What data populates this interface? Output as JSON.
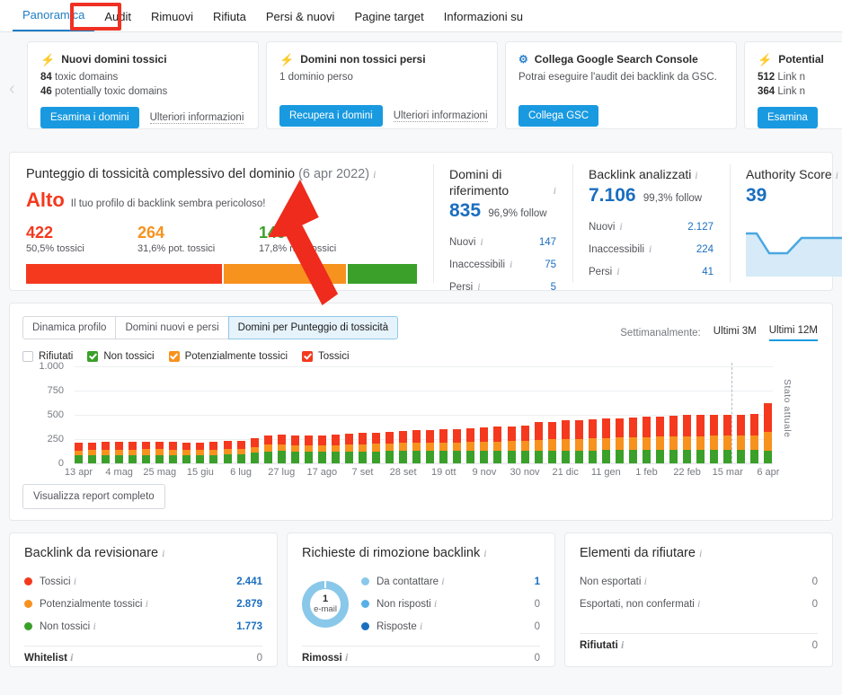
{
  "tabs": [
    {
      "label": "Panoramica",
      "active": true
    },
    {
      "label": "Audit",
      "active": false,
      "highlighted": true
    },
    {
      "label": "Rimuovi",
      "active": false
    },
    {
      "label": "Rifiuta",
      "active": false
    },
    {
      "label": "Persi & nuovi",
      "active": false
    },
    {
      "label": "Pagine target",
      "active": false
    },
    {
      "label": "Informazioni su",
      "active": false
    }
  ],
  "notifications": {
    "prev_arrow": "‹",
    "next_arrow": "›",
    "cards": [
      {
        "icon": "bolt-icon",
        "icon_color": "#f4391e",
        "title": "Nuovi domini tossici",
        "line1_value": "84",
        "line1_text": "toxic domains",
        "line2_value": "46",
        "line2_text": "potentially toxic domains",
        "button": "Esamina i domini",
        "link": "Ulteriori informazioni"
      },
      {
        "icon": "bolt-icon",
        "icon_color": "#f4391e",
        "title": "Domini non tossici persi",
        "line1_value": "1",
        "line1_text": "dominio perso",
        "line2_value": "",
        "line2_text": "",
        "button": "Recupera i domini",
        "link": "Ulteriori informazioni"
      },
      {
        "icon": "gear-icon",
        "icon_color": "#2a7fc9",
        "title": "Collega Google Search Console",
        "line1_value": "",
        "line1_text": "Potrai eseguire l'audit dei backlink da GSC.",
        "line2_value": "",
        "line2_text": "",
        "button": "Collega GSC",
        "link": ""
      },
      {
        "icon": "bolt-icon",
        "icon_color": "#f7921e",
        "title": "Potential",
        "line1_value": "512",
        "line1_text": "Link n",
        "line2_value": "364",
        "line2_text": "Link n",
        "button": "Esamina",
        "link": ""
      }
    ]
  },
  "toxicity": {
    "title": "Punteggio di tossicità complessivo del dominio",
    "date": "(6 apr 2022)",
    "info_icon": "i",
    "verdict": "Alto",
    "verdict_sub": "Il tuo profilo di backlink sembra pericoloso!",
    "segments": [
      {
        "value": "422",
        "label": "50,5% tossici",
        "color": "#f4391e",
        "pct": 50.5
      },
      {
        "value": "264",
        "label": "31,6% pot. tossici",
        "color": "#f7921e",
        "pct": 31.6
      },
      {
        "value": "149",
        "label": "17,8% non tossici",
        "color": "#3aa02a",
        "pct": 17.8
      }
    ]
  },
  "referring_domains": {
    "title": "Domini di riferimento",
    "big": "835",
    "side": "96,9% follow",
    "rows": [
      {
        "label": "Nuovi",
        "value": "147"
      },
      {
        "label": "Inaccessibili",
        "value": "75"
      },
      {
        "label": "Persi",
        "value": "5"
      }
    ]
  },
  "backlinks": {
    "title": "Backlink analizzati",
    "big": "7.106",
    "side": "99,3% follow",
    "rows": [
      {
        "label": "Nuovi",
        "value": "2.127"
      },
      {
        "label": "Inaccessibili",
        "value": "224"
      },
      {
        "label": "Persi",
        "value": "41"
      }
    ]
  },
  "authority_score": {
    "title": "Authority Score",
    "big": "39"
  },
  "chart_panel": {
    "segments": [
      {
        "label": "Dinamica profilo",
        "active": false
      },
      {
        "label": "Domini nuovi e persi",
        "active": false
      },
      {
        "label": "Domini per Punteggio di tossicità",
        "active": true
      }
    ],
    "legend": [
      {
        "label": "Rifiutati",
        "color": "#ffffff",
        "checked": false
      },
      {
        "label": "Non tossici",
        "color": "#3aa02a",
        "checked": true
      },
      {
        "label": "Potenzialmente tossici",
        "color": "#f7921e",
        "checked": true
      },
      {
        "label": "Tossici",
        "color": "#f4391e",
        "checked": true
      }
    ],
    "period_label": "Settimanalmente:",
    "period_options": [
      {
        "label": "Ultimi 3M",
        "active": false
      },
      {
        "label": "Ultimi 12M",
        "active": true
      }
    ],
    "current_marker_label": "Stato attuale",
    "full_report_button": "Visualizza report completo"
  },
  "chart_data": {
    "type": "bar",
    "title": "Domini per Punteggio di tossicità",
    "stacked": true,
    "xlabel": "",
    "ylabel": "",
    "ylim": [
      0,
      1000
    ],
    "yticks": [
      "1.000",
      "750",
      "500",
      "250",
      "0"
    ],
    "grid": true,
    "legend_position": "top-left",
    "categories": [
      "13 apr",
      "20 apr",
      "27 apr",
      "4 mag",
      "11 mag",
      "18 mag",
      "25 mag",
      "1 giu",
      "8 giu",
      "15 giu",
      "22 giu",
      "29 giu",
      "6 lug",
      "13 lug",
      "20 lug",
      "27 lug",
      "3 ago",
      "10 ago",
      "17 ago",
      "24 ago",
      "31 ago",
      "7 set",
      "14 set",
      "21 set",
      "28 set",
      "5 ott",
      "12 ott",
      "19 ott",
      "26 ott",
      "2 nov",
      "9 nov",
      "16 nov",
      "23 nov",
      "30 nov",
      "7 dic",
      "14 dic",
      "21 dic",
      "28 dic",
      "4 gen",
      "11 gen",
      "18 gen",
      "25 gen",
      "1 feb",
      "8 feb",
      "15 feb",
      "22 feb",
      "1 mar",
      "8 mar",
      "15 mar",
      "22 mar",
      "29 mar",
      "6 apr"
    ],
    "tick_labels_shown": [
      "13 apr",
      "4 mag",
      "25 mag",
      "15 giu",
      "6 lug",
      "27 lug",
      "17 ago",
      "7 set",
      "28 set",
      "19 ott",
      "9 nov",
      "30 nov",
      "21 dic",
      "11 gen",
      "1 feb",
      "22 feb",
      "15 mar",
      "6 apr"
    ],
    "series": [
      {
        "name": "Non tossici",
        "color": "#3aa02a",
        "values": [
          80,
          82,
          84,
          85,
          86,
          88,
          88,
          86,
          84,
          82,
          88,
          90,
          92,
          108,
          122,
          128,
          120,
          118,
          118,
          118,
          120,
          122,
          124,
          126,
          128,
          128,
          126,
          126,
          128,
          128,
          128,
          128,
          128,
          126,
          132,
          130,
          132,
          132,
          134,
          138,
          140,
          142,
          140,
          140,
          140,
          142,
          142,
          142,
          142,
          142,
          142,
          128
        ]
      },
      {
        "name": "Potenzialmente tossici",
        "color": "#f7921e",
        "values": [
          52,
          53,
          54,
          54,
          55,
          56,
          56,
          55,
          54,
          53,
          55,
          56,
          58,
          62,
          68,
          70,
          66,
          66,
          68,
          70,
          72,
          76,
          76,
          80,
          82,
          84,
          86,
          88,
          88,
          92,
          96,
          98,
          100,
          102,
          112,
          116,
          122,
          122,
          124,
          126,
          126,
          128,
          132,
          134,
          136,
          138,
          140,
          142,
          142,
          144,
          146,
          192
        ]
      },
      {
        "name": "Tossici",
        "color": "#f4391e",
        "values": [
          80,
          80,
          82,
          82,
          82,
          82,
          82,
          80,
          78,
          78,
          80,
          82,
          84,
          90,
          96,
          100,
          98,
          100,
          104,
          108,
          110,
          116,
          114,
          122,
          128,
          130,
          134,
          136,
          134,
          142,
          148,
          152,
          156,
          160,
          180,
          182,
          190,
          188,
          192,
          198,
          196,
          206,
          212,
          212,
          214,
          216,
          216,
          216,
          218,
          218,
          220,
          302
        ]
      }
    ],
    "current_point_index": 51,
    "current_point_label": "Stato attuale"
  },
  "review_card": {
    "title": "Backlink da revisionare",
    "rows": [
      {
        "label": "Tossici",
        "value": "2.441",
        "color": "#f4391e"
      },
      {
        "label": "Potenzialmente tossici",
        "value": "2.879",
        "color": "#f7921e"
      },
      {
        "label": "Non tossici",
        "value": "1.773",
        "color": "#3aa02a"
      }
    ],
    "total_label": "Whitelist",
    "total_value": "0"
  },
  "removal_card": {
    "title": "Richieste di rimozione backlink",
    "donut_value": "1",
    "donut_label": "e-mail",
    "rows": [
      {
        "label": "Da contattare",
        "value": "1",
        "color": "#8ac8ea"
      },
      {
        "label": "Non risposti",
        "value": "0",
        "color": "#56b0e6"
      },
      {
        "label": "Risposte",
        "value": "0",
        "color": "#1a6ec0"
      }
    ],
    "total_label": "Rimossi",
    "total_value": "0"
  },
  "disavow_card": {
    "title": "Elementi da rifiutare",
    "rows": [
      {
        "label": "Non esportati",
        "value": "0"
      },
      {
        "label": "Esportati, non confermati",
        "value": "0"
      }
    ],
    "total_label": "Rifiutati",
    "total_value": "0"
  }
}
